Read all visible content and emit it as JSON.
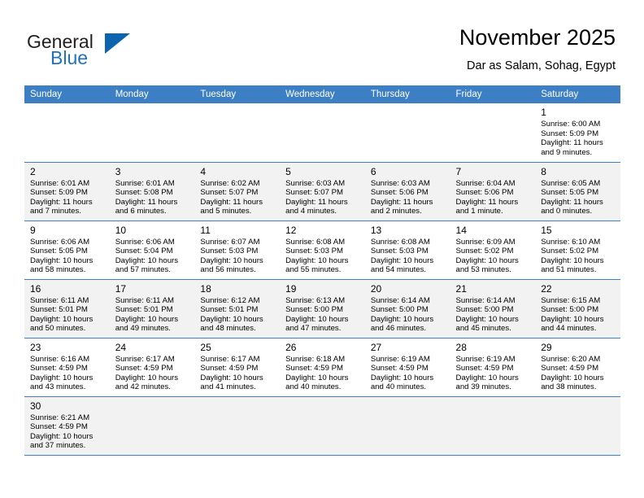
{
  "logo": {
    "word1": "General",
    "word2": "Blue",
    "triangle_color": "#0b64ad",
    "text_color": "#231f20",
    "blue_color": "#1f72bb"
  },
  "header": {
    "title": "November 2025",
    "subtitle": "Dar as Salam, Sohag, Egypt",
    "header_bg": "#3c7fc4",
    "header_text": "#ffffff"
  },
  "weekdays": [
    "Sunday",
    "Monday",
    "Tuesday",
    "Wednesday",
    "Thursday",
    "Friday",
    "Saturday"
  ],
  "weeks": [
    [
      {
        "day": "",
        "detail": ""
      },
      {
        "day": "",
        "detail": ""
      },
      {
        "day": "",
        "detail": ""
      },
      {
        "day": "",
        "detail": ""
      },
      {
        "day": "",
        "detail": ""
      },
      {
        "day": "",
        "detail": ""
      },
      {
        "day": "1",
        "detail": "Sunrise: 6:00 AM\nSunset: 5:09 PM\nDaylight: 11 hours\nand 9 minutes."
      }
    ],
    [
      {
        "day": "2",
        "detail": "Sunrise: 6:01 AM\nSunset: 5:09 PM\nDaylight: 11 hours\nand 7 minutes."
      },
      {
        "day": "3",
        "detail": "Sunrise: 6:01 AM\nSunset: 5:08 PM\nDaylight: 11 hours\nand 6 minutes."
      },
      {
        "day": "4",
        "detail": "Sunrise: 6:02 AM\nSunset: 5:07 PM\nDaylight: 11 hours\nand 5 minutes."
      },
      {
        "day": "5",
        "detail": "Sunrise: 6:03 AM\nSunset: 5:07 PM\nDaylight: 11 hours\nand 4 minutes."
      },
      {
        "day": "6",
        "detail": "Sunrise: 6:03 AM\nSunset: 5:06 PM\nDaylight: 11 hours\nand 2 minutes."
      },
      {
        "day": "7",
        "detail": "Sunrise: 6:04 AM\nSunset: 5:06 PM\nDaylight: 11 hours\nand 1 minute."
      },
      {
        "day": "8",
        "detail": "Sunrise: 6:05 AM\nSunset: 5:05 PM\nDaylight: 11 hours\nand 0 minutes."
      }
    ],
    [
      {
        "day": "9",
        "detail": "Sunrise: 6:06 AM\nSunset: 5:05 PM\nDaylight: 10 hours\nand 58 minutes."
      },
      {
        "day": "10",
        "detail": "Sunrise: 6:06 AM\nSunset: 5:04 PM\nDaylight: 10 hours\nand 57 minutes."
      },
      {
        "day": "11",
        "detail": "Sunrise: 6:07 AM\nSunset: 5:03 PM\nDaylight: 10 hours\nand 56 minutes."
      },
      {
        "day": "12",
        "detail": "Sunrise: 6:08 AM\nSunset: 5:03 PM\nDaylight: 10 hours\nand 55 minutes."
      },
      {
        "day": "13",
        "detail": "Sunrise: 6:08 AM\nSunset: 5:03 PM\nDaylight: 10 hours\nand 54 minutes."
      },
      {
        "day": "14",
        "detail": "Sunrise: 6:09 AM\nSunset: 5:02 PM\nDaylight: 10 hours\nand 53 minutes."
      },
      {
        "day": "15",
        "detail": "Sunrise: 6:10 AM\nSunset: 5:02 PM\nDaylight: 10 hours\nand 51 minutes."
      }
    ],
    [
      {
        "day": "16",
        "detail": "Sunrise: 6:11 AM\nSunset: 5:01 PM\nDaylight: 10 hours\nand 50 minutes."
      },
      {
        "day": "17",
        "detail": "Sunrise: 6:11 AM\nSunset: 5:01 PM\nDaylight: 10 hours\nand 49 minutes."
      },
      {
        "day": "18",
        "detail": "Sunrise: 6:12 AM\nSunset: 5:01 PM\nDaylight: 10 hours\nand 48 minutes."
      },
      {
        "day": "19",
        "detail": "Sunrise: 6:13 AM\nSunset: 5:00 PM\nDaylight: 10 hours\nand 47 minutes."
      },
      {
        "day": "20",
        "detail": "Sunrise: 6:14 AM\nSunset: 5:00 PM\nDaylight: 10 hours\nand 46 minutes."
      },
      {
        "day": "21",
        "detail": "Sunrise: 6:14 AM\nSunset: 5:00 PM\nDaylight: 10 hours\nand 45 minutes."
      },
      {
        "day": "22",
        "detail": "Sunrise: 6:15 AM\nSunset: 5:00 PM\nDaylight: 10 hours\nand 44 minutes."
      }
    ],
    [
      {
        "day": "23",
        "detail": "Sunrise: 6:16 AM\nSunset: 4:59 PM\nDaylight: 10 hours\nand 43 minutes."
      },
      {
        "day": "24",
        "detail": "Sunrise: 6:17 AM\nSunset: 4:59 PM\nDaylight: 10 hours\nand 42 minutes."
      },
      {
        "day": "25",
        "detail": "Sunrise: 6:17 AM\nSunset: 4:59 PM\nDaylight: 10 hours\nand 41 minutes."
      },
      {
        "day": "26",
        "detail": "Sunrise: 6:18 AM\nSunset: 4:59 PM\nDaylight: 10 hours\nand 40 minutes."
      },
      {
        "day": "27",
        "detail": "Sunrise: 6:19 AM\nSunset: 4:59 PM\nDaylight: 10 hours\nand 40 minutes."
      },
      {
        "day": "28",
        "detail": "Sunrise: 6:19 AM\nSunset: 4:59 PM\nDaylight: 10 hours\nand 39 minutes."
      },
      {
        "day": "29",
        "detail": "Sunrise: 6:20 AM\nSunset: 4:59 PM\nDaylight: 10 hours\nand 38 minutes."
      }
    ],
    [
      {
        "day": "30",
        "detail": "Sunrise: 6:21 AM\nSunset: 4:59 PM\nDaylight: 10 hours\nand 37 minutes."
      },
      {
        "day": "",
        "detail": ""
      },
      {
        "day": "",
        "detail": ""
      },
      {
        "day": "",
        "detail": ""
      },
      {
        "day": "",
        "detail": ""
      },
      {
        "day": "",
        "detail": ""
      },
      {
        "day": "",
        "detail": ""
      }
    ]
  ]
}
